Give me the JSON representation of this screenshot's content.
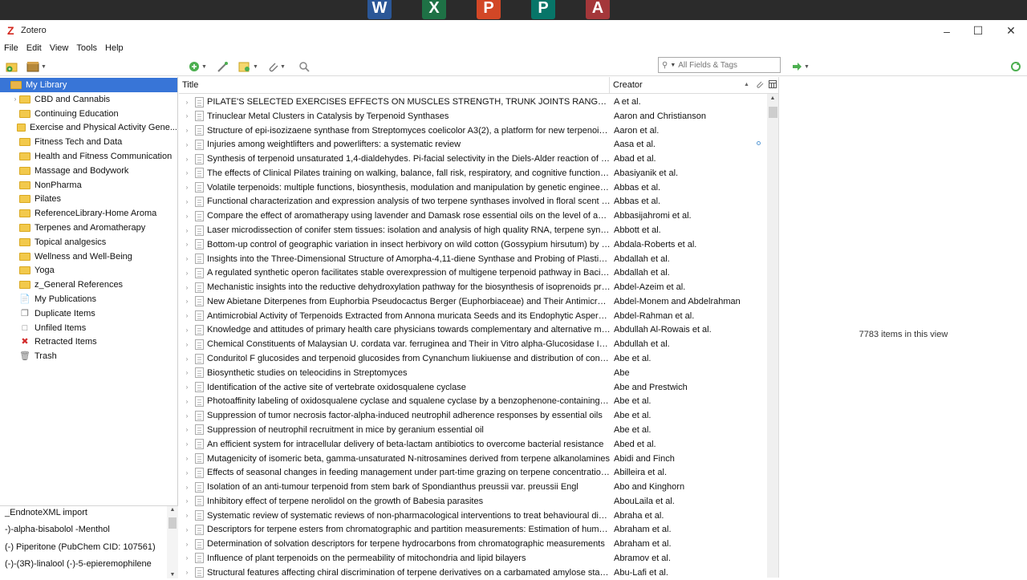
{
  "window": {
    "title": "Zotero"
  },
  "taskbar": {
    "apps": [
      {
        "name": "word-icon",
        "letter": "W",
        "color": "#2b5797"
      },
      {
        "name": "excel-icon",
        "letter": "X",
        "color": "#1e7145"
      },
      {
        "name": "powerpoint-icon",
        "letter": "P",
        "color": "#d24726"
      },
      {
        "name": "publisher-icon",
        "letter": "P",
        "color": "#077568"
      },
      {
        "name": "access-icon",
        "letter": "A",
        "color": "#a4373a"
      }
    ]
  },
  "menu": {
    "file": "File",
    "edit": "Edit",
    "view": "View",
    "tools": "Tools",
    "help": "Help"
  },
  "search": {
    "placeholder": "All Fields & Tags"
  },
  "collections": [
    {
      "label": "My Library",
      "type": "library",
      "selected": true,
      "twisty": false
    },
    {
      "label": "CBD and Cannabis",
      "type": "folder",
      "twisty": true
    },
    {
      "label": "Continuing Education",
      "type": "folder"
    },
    {
      "label": "Exercise and Physical Activity Gene...",
      "type": "folder"
    },
    {
      "label": "Fitness Tech and Data",
      "type": "folder"
    },
    {
      "label": "Health and Fitness Communication",
      "type": "folder"
    },
    {
      "label": "Massage and Bodywork",
      "type": "folder"
    },
    {
      "label": "NonPharma",
      "type": "folder"
    },
    {
      "label": "Pilates",
      "type": "folder"
    },
    {
      "label": "ReferenceLibrary-Home Aroma",
      "type": "folder"
    },
    {
      "label": "Terpenes and Aromatherapy",
      "type": "folder"
    },
    {
      "label": "Topical analgesics",
      "type": "folder"
    },
    {
      "label": "Wellness and Well-Being",
      "type": "folder"
    },
    {
      "label": "Yoga",
      "type": "folder"
    },
    {
      "label": "z_General References",
      "type": "folder"
    },
    {
      "label": "My Publications",
      "type": "publications"
    },
    {
      "label": "Duplicate Items",
      "type": "duplicates"
    },
    {
      "label": "Unfiled Items",
      "type": "unfiled"
    },
    {
      "label": "Retracted Items",
      "type": "retracted"
    },
    {
      "label": "Trash",
      "type": "trash"
    }
  ],
  "tags": [
    "_EndnoteXML import",
    "-)-alpha-bisabolol   -Menthol",
    "(-) Piperitone (PubChem CID: 107561)",
    "(-)-(3R)-linalool   (-)-5-epieremophilene"
  ],
  "columns": {
    "title": "Title",
    "creator": "Creator"
  },
  "items": [
    {
      "title": "PILATE'S SELECTED EXERCISES EFFECTS ON MUSCLES STRENGTH, TRUNK JOINTS RANGE OF MOTION AN...",
      "creator": "A et al."
    },
    {
      "title": "Trinuclear Metal Clusters in Catalysis by Terpenoid Synthases",
      "creator": "Aaron and Christianson"
    },
    {
      "title": "Structure of epi-isozizaene synthase from Streptomyces coelicolor A3(2), a platform for new terpenoid cy...",
      "creator": "Aaron et al."
    },
    {
      "title": "Injuries among weightlifters and powerlifters: a systematic review",
      "creator": "Aasa et al."
    },
    {
      "title": "Synthesis of terpenoid unsaturated 1,4-dialdehydes. Pi-facial selectivity in the Diels-Alder reaction of the ...",
      "creator": "Abad et al."
    },
    {
      "title": "The effects of Clinical Pilates training on walking, balance, fall risk, respiratory, and cognitive functions in ...",
      "creator": "Abasiyanik et al."
    },
    {
      "title": "Volatile terpenoids: multiple functions, biosynthesis, modulation and manipulation by genetic engineering",
      "creator": "Abbas et al."
    },
    {
      "title": "Functional characterization and expression analysis of two terpene synthases involved in floral scent form...",
      "creator": "Abbas et al."
    },
    {
      "title": "Compare the effect of aromatherapy using lavender and Damask rose essential oils on the level of anxiety...",
      "creator": "Abbasijahromi et al."
    },
    {
      "title": "Laser microdissection of conifer stem tissues: isolation and analysis of high quality RNA, terpene synthas...",
      "creator": "Abbott et al."
    },
    {
      "title": "Bottom-up control of geographic variation in insect herbivory on wild cotton (Gossypium hirsutum) by p...",
      "creator": "Abdala-Roberts et al."
    },
    {
      "title": "Insights into the Three-Dimensional Structure of Amorpha-4,11-diene Synthase and Probing of Plasticity ...",
      "creator": "Abdallah et al."
    },
    {
      "title": "A regulated synthetic operon facilitates stable overexpression of multigene terpenoid pathway in Bacillus ...",
      "creator": "Abdallah et al."
    },
    {
      "title": "Mechanistic insights into the reductive dehydroxylation pathway for the biosynthesis of isoprenoids pro...",
      "creator": "Abdel-Azeim et al."
    },
    {
      "title": "New Abietane Diterpenes from Euphorbia Pseudocactus Berger (Euphorbiaceae) and Their Antimicrobial ...",
      "creator": "Abdel-Monem and Abdelrahman"
    },
    {
      "title": "Antimicrobial Activity of Terpenoids Extracted from Annona muricata Seeds and its Endophytic Aspergill...",
      "creator": "Abdel-Rahman et al."
    },
    {
      "title": "Knowledge and attitudes of primary health care physicians towards complementary and alternative medi...",
      "creator": "Abdullah Al-Rowais et al."
    },
    {
      "title": "Chemical Constituents of Malaysian U. cordata var. ferruginea and Their in Vitro alpha-Glucosidase Inhibi...",
      "creator": "Abdullah et al."
    },
    {
      "title": "Conduritol F glucosides and terpenoid glucosides from Cynanchum liukiuense and distribution of condu...",
      "creator": "Abe et al."
    },
    {
      "title": "Biosynthetic studies on teleocidins in Streptomyces",
      "creator": "Abe"
    },
    {
      "title": "Identification of the active site of vertebrate oxidosqualene cyclase",
      "creator": "Abe and Prestwich"
    },
    {
      "title": "Photoaffinity labeling of oxidosqualene cyclase and squalene cyclase by a benzophenone-containing inh...",
      "creator": "Abe et al."
    },
    {
      "title": "Suppression of tumor necrosis factor-alpha-induced neutrophil adherence responses by essential oils",
      "creator": "Abe et al."
    },
    {
      "title": "Suppression of neutrophil recruitment in mice by geranium essential oil",
      "creator": "Abe et al."
    },
    {
      "title": "An efficient system for intracellular delivery of beta-lactam antibiotics to overcome bacterial resistance",
      "creator": "Abed et al."
    },
    {
      "title": "Mutagenicity of isomeric beta, gamma-unsaturated N-nitrosamines derived from terpene alkanolamines",
      "creator": "Abidi and Finch"
    },
    {
      "title": "Effects of seasonal changes in feeding management under part-time grazing on terpene concentrations ...",
      "creator": "Abilleira et al."
    },
    {
      "title": "Isolation of an anti-tumour terpenoid from stem bark of Spondianthus preussii var. preussii Engl",
      "creator": "Abo and Kinghorn"
    },
    {
      "title": "Inhibitory effect of terpene nerolidol on the growth of Babesia parasites",
      "creator": "AbouLaila et al."
    },
    {
      "title": "Systematic review of systematic reviews of non-pharmacological interventions to treat behavioural distur...",
      "creator": "Abraha et al."
    },
    {
      "title": "Descriptors for terpene esters from chromatographic and partition measurements: Estimation of human ...",
      "creator": "Abraham et al."
    },
    {
      "title": "Determination of solvation descriptors for terpene hydrocarbons from chromatographic measurements",
      "creator": "Abraham et al."
    },
    {
      "title": "Influence of plant terpenoids on the permeability of mitochondria and lipid bilayers",
      "creator": "Abramov et al."
    },
    {
      "title": "Structural features affecting chiral discrimination of terpene derivatives on a carbamated amylose station...",
      "creator": "Abu-Lafi et al."
    }
  ],
  "status": {
    "count_message": "7783 items in this view"
  }
}
